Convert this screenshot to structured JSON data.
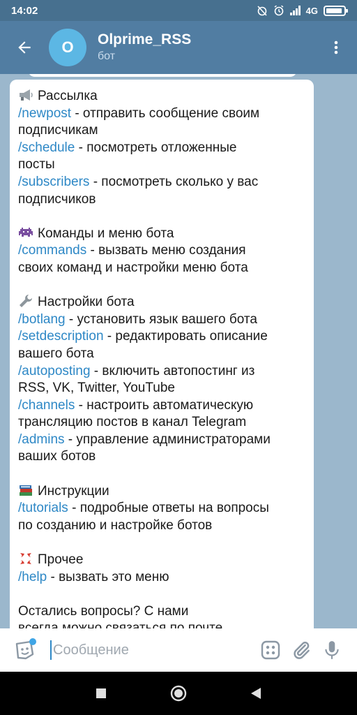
{
  "status_bar": {
    "time": "14:02",
    "network": "4G",
    "battery_level": 0.9
  },
  "header": {
    "back_icon": "arrow-left-icon",
    "avatar_letter": "O",
    "avatar_color": "#5cb7e4",
    "title": "Olprime_RSS",
    "subtitle": "бот",
    "menu_icon": "more-vertical-icon"
  },
  "message": {
    "sections": [
      {
        "emoji": "megaphone-icon",
        "heading": "Рассылка",
        "lines": [
          {
            "cmd": "/newpost",
            "text": " - отправить сообщение своим"
          },
          {
            "cmd": "",
            "text": "подписчикам"
          },
          {
            "cmd": "/schedule",
            "text": " - посмотреть отложенные"
          },
          {
            "cmd": "",
            "text": "посты"
          },
          {
            "cmd": "/subscribers",
            "text": " - посмотреть сколько у вас"
          },
          {
            "cmd": "",
            "text": "подписчиков"
          }
        ]
      },
      {
        "emoji": "space-invader-icon",
        "heading": "Команды и меню бота",
        "lines": [
          {
            "cmd": "/commands",
            "text": " - вызвать меню создания"
          },
          {
            "cmd": "",
            "text": "своих команд и настройки меню бота"
          }
        ]
      },
      {
        "emoji": "wrench-icon",
        "heading": "Настройки бота",
        "lines": [
          {
            "cmd": "/botlang",
            "text": " - установить язык вашего бота"
          },
          {
            "cmd": "/setdescription",
            "text": " - редактировать описание"
          },
          {
            "cmd": "",
            "text": "вашего бота"
          },
          {
            "cmd": "/autoposting",
            "text": " - включить автопостинг из"
          },
          {
            "cmd": "",
            "text": "RSS, VK, Twitter, YouTube"
          },
          {
            "cmd": "/channels",
            "text": " - настроить автоматическую"
          },
          {
            "cmd": "",
            "text": "трансляцию постов в канал Telegram"
          },
          {
            "cmd": "/admins",
            "text": " - управление администраторами"
          },
          {
            "cmd": "",
            "text": "ваших ботов"
          }
        ]
      },
      {
        "emoji": "books-icon",
        "heading": "Инструкции",
        "lines": [
          {
            "cmd": "/tutorials",
            "text": " - подробные ответы на вопросы"
          },
          {
            "cmd": "",
            "text": "по созданию и настройке ботов"
          }
        ]
      },
      {
        "emoji": "anger-symbol-icon",
        "heading": "Прочее",
        "lines": [
          {
            "cmd": "/help",
            "text": " - вызвать это меню"
          }
        ]
      },
      {
        "emoji": "",
        "heading": "",
        "lines": [
          {
            "cmd": "",
            "text": "Остались вопросы? С нами"
          },
          {
            "cmd": "",
            "text": "всегда можно связаться по почте"
          }
        ]
      }
    ]
  },
  "input_bar": {
    "sticker_icon": "sticker-icon",
    "placeholder": "Сообщение",
    "commands_icon": "bot-commands-icon",
    "attach_icon": "paperclip-icon",
    "mic_icon": "microphone-icon"
  },
  "nav_bar": {
    "recent_icon": "square-icon",
    "home_icon": "circle-icon",
    "back_icon": "triangle-back-icon"
  }
}
